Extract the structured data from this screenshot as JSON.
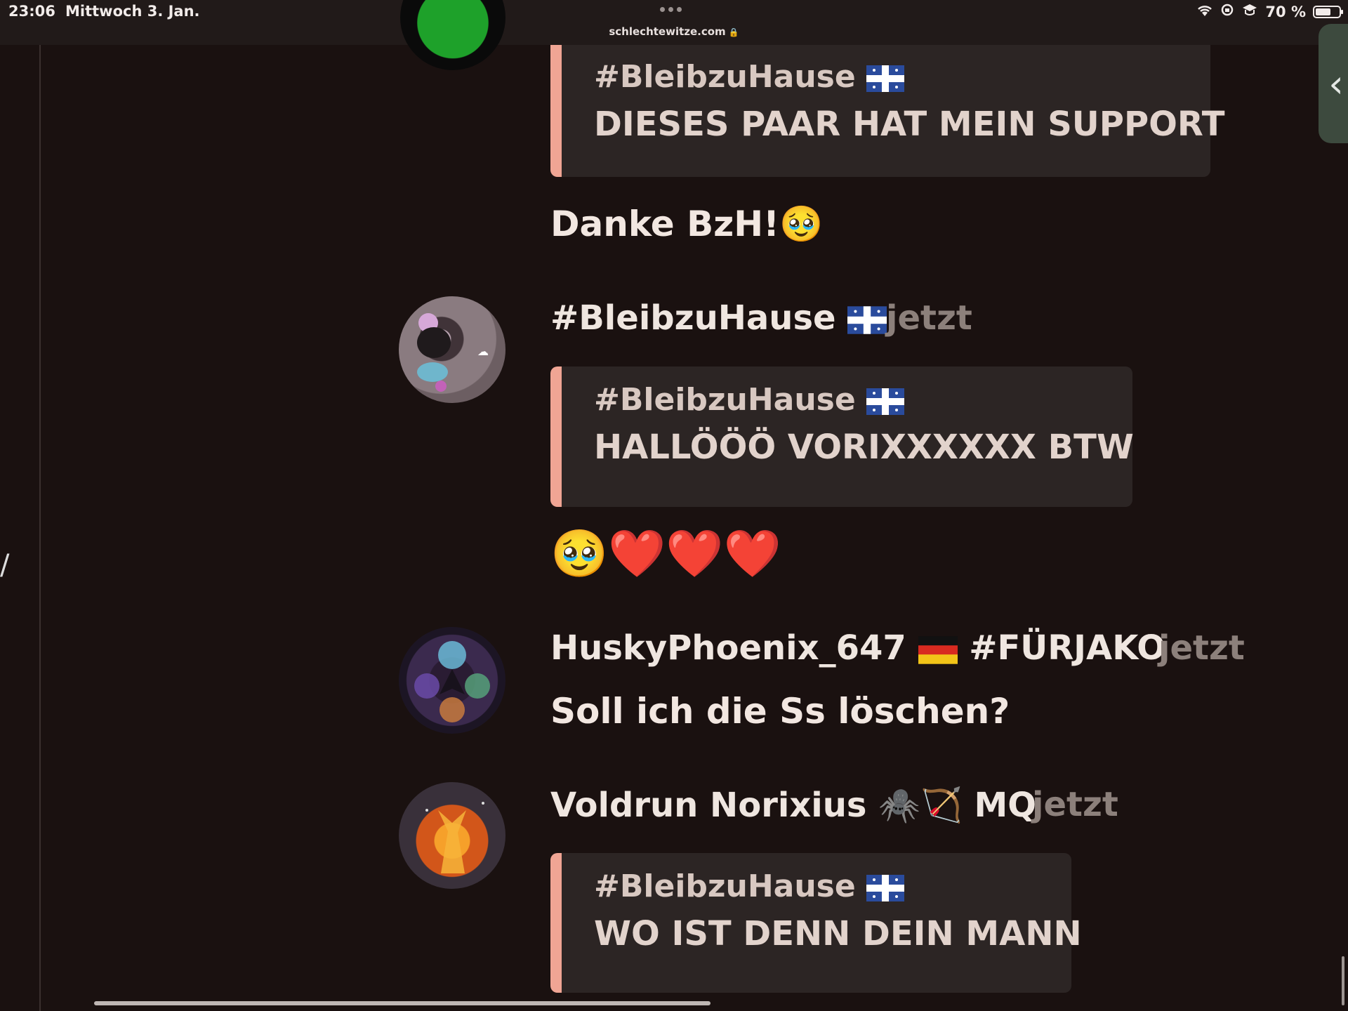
{
  "status_bar": {
    "time": "23:06",
    "date": "Mittwoch 3. Jan.",
    "url": "schlechtewitze.com",
    "battery": "70 %",
    "battery_level": 0.7
  },
  "feed": {
    "q1": {
      "author": "#BleibzuHause",
      "text": "DIESES PAAR HAT MEIN SUPPORT"
    },
    "m1": {
      "text": "Danke BzH!",
      "emoji": "🥹"
    },
    "post2": {
      "author": "#BleibzuHause",
      "time": "jetzt",
      "quote": {
        "author": "#BleibzuHause",
        "text": "HALLÖÖÖ VORIXXXXXX BTW"
      },
      "emoji_text": "🥹❤️❤️❤️"
    },
    "post3": {
      "author": "HuskyPhoenix_647",
      "flag": "🇩🇪",
      "tag": "#FÜRJAKO",
      "time": "jetzt",
      "text": "Soll ich die Ss löschen?"
    },
    "post4": {
      "author": "Voldrun Norixius",
      "emojis": "🕷️🏹",
      "suffix": "MQ",
      "time": "jetzt",
      "quote": {
        "author": "#BleibzuHause",
        "text": "WO IST DENN DEIN MANN"
      }
    }
  }
}
